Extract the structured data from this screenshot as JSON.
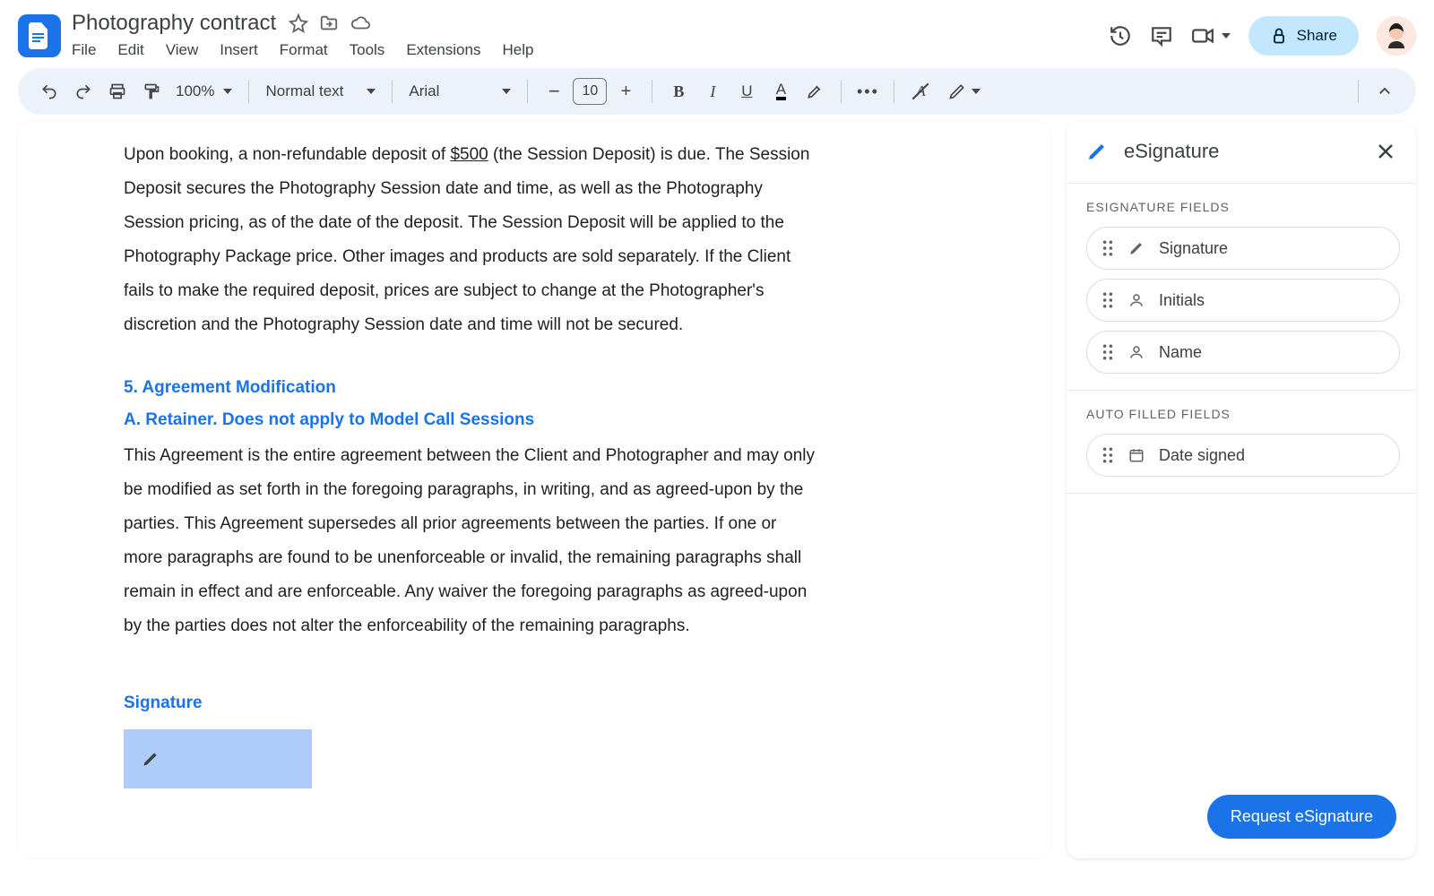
{
  "header": {
    "doc_title": "Photography contract",
    "menus": [
      "File",
      "Edit",
      "View",
      "Insert",
      "Format",
      "Tools",
      "Extensions",
      "Help"
    ],
    "share_label": "Share"
  },
  "toolbar": {
    "zoom": "100%",
    "style": "Normal text",
    "font": "Arial",
    "font_size": "10"
  },
  "document": {
    "para1_a": "Upon booking, a non-refundable deposit of ",
    "para1_amount": "$500",
    "para1_b": " (the Session Deposit) is due. The Session Deposit secures the Photography Session date and time, as well as the Photography Session pricing, as of the date of the deposit. The Session Deposit will be applied to the Photography Package price. Other images and products are sold separately. If the Client fails to make the required deposit, prices are subject to change at the Photographer's discretion and the Photography Session date and time will not be secured.",
    "heading5": "5. Agreement Modification",
    "headingA": "A. Retainer.  Does not apply to Model Call Sessions",
    "para2": "This Agreement is the entire agreement between the Client and Photographer and may only be modified as set forth in the foregoing paragraphs, in writing, and as agreed-upon by the parties.  This Agreement supersedes all prior agreements between the parties. If one or more paragraphs are found to be unenforceable or invalid, the remaining paragraphs shall remain in effect and are enforceable. Any waiver the foregoing paragraphs as agreed-upon by the parties does not alter the enforceability of the remaining paragraphs.",
    "signature_label": "Signature"
  },
  "panel": {
    "title": "eSignature",
    "section1_title": "ESIGNATURE FIELDS",
    "fields": {
      "signature": "Signature",
      "initials": "Initials",
      "name": "Name"
    },
    "section2_title": "AUTO FILLED FIELDS",
    "auto_fields": {
      "date_signed": "Date signed"
    },
    "request_label": "Request eSignature"
  }
}
